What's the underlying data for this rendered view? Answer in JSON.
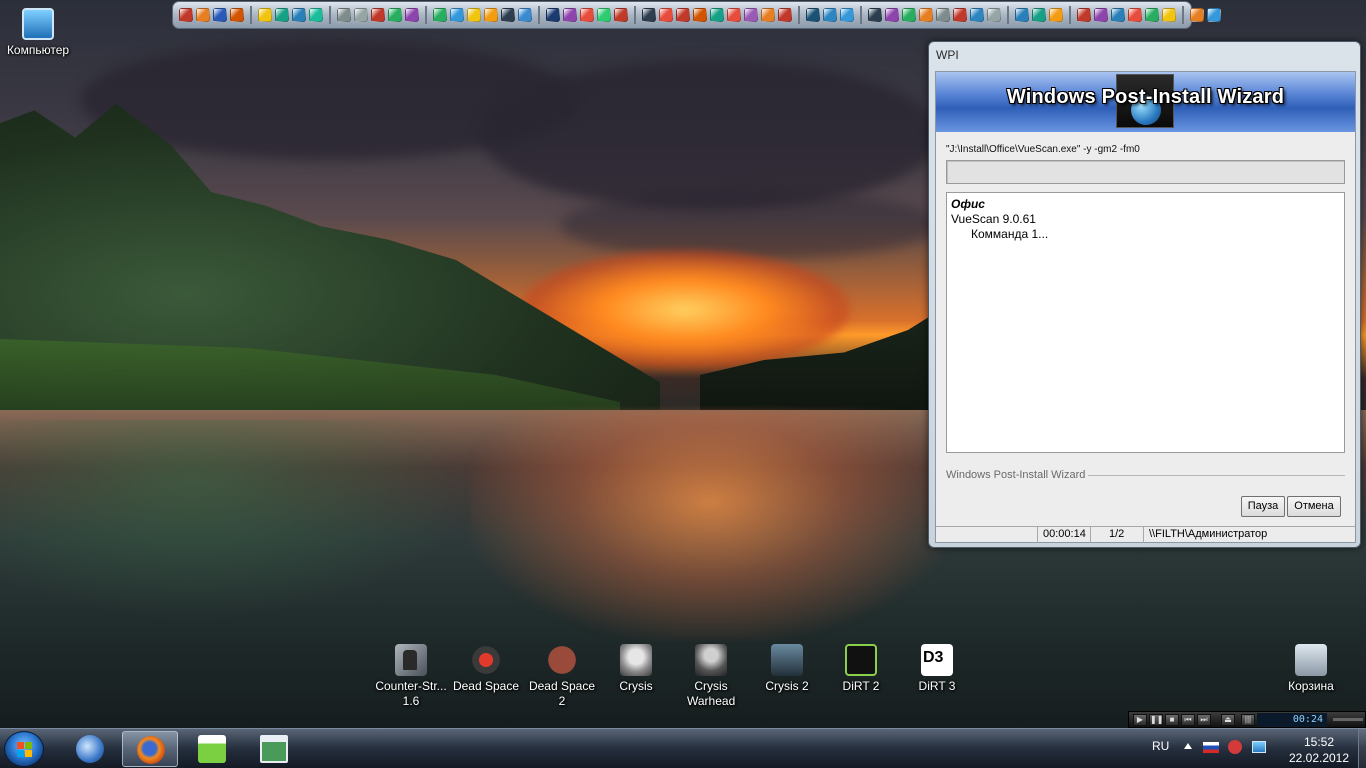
{
  "desktop": {
    "top_left_icon": {
      "label": "Компьютер"
    },
    "recycle_bin": {
      "label": "Корзина"
    },
    "game_icons": [
      {
        "label": "Counter-Str... 1.6"
      },
      {
        "label": "Dead Space"
      },
      {
        "label": "Dead Space 2"
      },
      {
        "label": "Crysis"
      },
      {
        "label": "Crysis Warhead"
      },
      {
        "label": "Crysis 2"
      },
      {
        "label": "DiRT 2"
      },
      {
        "label": "DiRT 3"
      }
    ]
  },
  "wpi_window": {
    "title": "WPI",
    "banner_title": "Windows Post-Install Wizard",
    "command": "\"J:\\Install\\Office\\VueScan.exe\" -y -gm2 -fm0",
    "list": {
      "category": "Офис",
      "program": "VueScan 9.0.61",
      "command_line": "Комманда 1..."
    },
    "group_label": "Windows Post-Install Wizard",
    "buttons": {
      "pause": "Пауза",
      "cancel": "Отмена"
    },
    "status": {
      "elapsed": "00:00:14",
      "step": "1/2",
      "user": "\\\\FILTH\\Администратор"
    }
  },
  "mini_player": {
    "time": "00:24"
  },
  "taskbar": {
    "language": "RU",
    "clock_time": "15:52",
    "clock_date": "22.02.2012",
    "pinned": [
      "thunderbird-icon",
      "firefox-icon",
      "winamp-icon",
      "wpi-app-icon"
    ]
  },
  "colors": {
    "banner_blue": "#2f5fb8",
    "taskbar_dark": "#1e2837",
    "window_frame": "#c9d3dc"
  }
}
